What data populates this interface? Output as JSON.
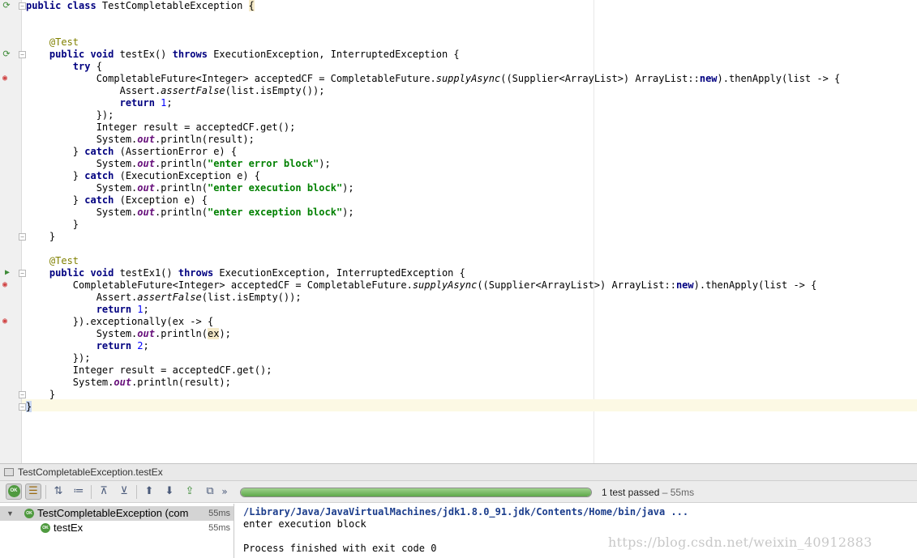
{
  "editor": {
    "code_lines": [
      [
        {
          "t": "kw",
          "v": "public class "
        },
        {
          "t": "txt",
          "v": "TestCompletableException "
        },
        {
          "t": "hl",
          "v": "{"
        }
      ],
      [],
      [],
      [
        {
          "t": "ann",
          "v": "    @Test"
        }
      ],
      [
        {
          "t": "kw",
          "v": "    public void "
        },
        {
          "t": "txt",
          "v": "testEx() "
        },
        {
          "t": "kw",
          "v": "throws "
        },
        {
          "t": "txt",
          "v": "ExecutionException, InterruptedException {"
        }
      ],
      [
        {
          "t": "kw",
          "v": "        try "
        },
        {
          "t": "txt",
          "v": "{"
        }
      ],
      [
        {
          "t": "txt",
          "v": "            CompletableFuture<Integer> acceptedCF = CompletableFuture."
        },
        {
          "t": "mi",
          "v": "supplyAsync"
        },
        {
          "t": "txt",
          "v": "((Supplier<ArrayList>) ArrayList::"
        },
        {
          "t": "kw",
          "v": "new"
        },
        {
          "t": "txt",
          "v": ").thenApply(list -> {"
        }
      ],
      [
        {
          "t": "txt",
          "v": "                Assert."
        },
        {
          "t": "mi",
          "v": "assertFalse"
        },
        {
          "t": "txt",
          "v": "(list.isEmpty());"
        }
      ],
      [
        {
          "t": "kw",
          "v": "                return "
        },
        {
          "t": "num",
          "v": "1"
        },
        {
          "t": "txt",
          "v": ";"
        }
      ],
      [
        {
          "t": "txt",
          "v": "            });"
        }
      ],
      [
        {
          "t": "txt",
          "v": "            Integer result = acceptedCF.get();"
        }
      ],
      [
        {
          "t": "txt",
          "v": "            System."
        },
        {
          "t": "st",
          "v": "out"
        },
        {
          "t": "txt",
          "v": ".println(result);"
        }
      ],
      [
        {
          "t": "txt",
          "v": "        } "
        },
        {
          "t": "kw",
          "v": "catch "
        },
        {
          "t": "txt",
          "v": "(AssertionError e) {"
        }
      ],
      [
        {
          "t": "txt",
          "v": "            System."
        },
        {
          "t": "st",
          "v": "out"
        },
        {
          "t": "txt",
          "v": ".println("
        },
        {
          "t": "str",
          "v": "\"enter error block\""
        },
        {
          "t": "txt",
          "v": ");"
        }
      ],
      [
        {
          "t": "txt",
          "v": "        } "
        },
        {
          "t": "kw",
          "v": "catch "
        },
        {
          "t": "txt",
          "v": "(ExecutionException e) {"
        }
      ],
      [
        {
          "t": "txt",
          "v": "            System."
        },
        {
          "t": "st",
          "v": "out"
        },
        {
          "t": "txt",
          "v": ".println("
        },
        {
          "t": "str",
          "v": "\"enter execution block\""
        },
        {
          "t": "txt",
          "v": ");"
        }
      ],
      [
        {
          "t": "txt",
          "v": "        } "
        },
        {
          "t": "kw",
          "v": "catch "
        },
        {
          "t": "txt",
          "v": "(Exception e) {"
        }
      ],
      [
        {
          "t": "txt",
          "v": "            System."
        },
        {
          "t": "st",
          "v": "out"
        },
        {
          "t": "txt",
          "v": ".println("
        },
        {
          "t": "str",
          "v": "\"enter exception block\""
        },
        {
          "t": "txt",
          "v": ");"
        }
      ],
      [
        {
          "t": "txt",
          "v": "        }"
        }
      ],
      [
        {
          "t": "txt",
          "v": "    }"
        }
      ],
      [],
      [
        {
          "t": "ann",
          "v": "    @Test"
        }
      ],
      [
        {
          "t": "kw",
          "v": "    public void "
        },
        {
          "t": "txt",
          "v": "testEx1() "
        },
        {
          "t": "kw",
          "v": "throws "
        },
        {
          "t": "txt",
          "v": "ExecutionException, InterruptedException {"
        }
      ],
      [
        {
          "t": "txt",
          "v": "        CompletableFuture<Integer> acceptedCF = CompletableFuture."
        },
        {
          "t": "mi",
          "v": "supplyAsync"
        },
        {
          "t": "txt",
          "v": "((Supplier<ArrayList>) ArrayList::"
        },
        {
          "t": "kw",
          "v": "new"
        },
        {
          "t": "txt",
          "v": ").thenApply(list -> {"
        }
      ],
      [
        {
          "t": "txt",
          "v": "            Assert."
        },
        {
          "t": "mi",
          "v": "assertFalse"
        },
        {
          "t": "txt",
          "v": "(list.isEmpty());"
        }
      ],
      [
        {
          "t": "kw",
          "v": "            return "
        },
        {
          "t": "num",
          "v": "1"
        },
        {
          "t": "txt",
          "v": ";"
        }
      ],
      [
        {
          "t": "txt",
          "v": "        }).exceptionally(ex -> {"
        }
      ],
      [
        {
          "t": "txt",
          "v": "            System."
        },
        {
          "t": "st",
          "v": "out"
        },
        {
          "t": "txt",
          "v": ".println("
        },
        {
          "t": "hl",
          "v": "ex"
        },
        {
          "t": "txt",
          "v": ");"
        }
      ],
      [
        {
          "t": "kw",
          "v": "            return "
        },
        {
          "t": "num",
          "v": "2"
        },
        {
          "t": "txt",
          "v": ";"
        }
      ],
      [
        {
          "t": "txt",
          "v": "        });"
        }
      ],
      [
        {
          "t": "txt",
          "v": "        Integer result = acceptedCF.get();"
        }
      ],
      [
        {
          "t": "txt",
          "v": "        System."
        },
        {
          "t": "st",
          "v": "out"
        },
        {
          "t": "txt",
          "v": ".println(result);"
        }
      ],
      [
        {
          "t": "txt",
          "v": "    }"
        }
      ],
      [
        {
          "t": "brace",
          "v": "}"
        }
      ]
    ]
  },
  "run_panel": {
    "header_title": "TestCompletableException.testEx",
    "toolbar": {
      "passed_badge": "OK",
      "more_label": "»"
    },
    "progress_fraction": 1.0,
    "status": {
      "summary": "1 test passed",
      "separator": " – ",
      "duration": "55ms"
    },
    "tree": [
      {
        "name": "TestCompletableException (com",
        "duration": "55ms",
        "badge": "OK"
      },
      {
        "name": "testEx",
        "duration": "55ms",
        "badge": "OK"
      }
    ],
    "console": [
      "/Library/Java/JavaVirtualMachines/jdk1.8.0_91.jdk/Contents/Home/bin/java ...",
      "enter execution block",
      "",
      "Process finished with exit code 0"
    ]
  },
  "watermark": "https://blog.csdn.net/weixin_40912883"
}
